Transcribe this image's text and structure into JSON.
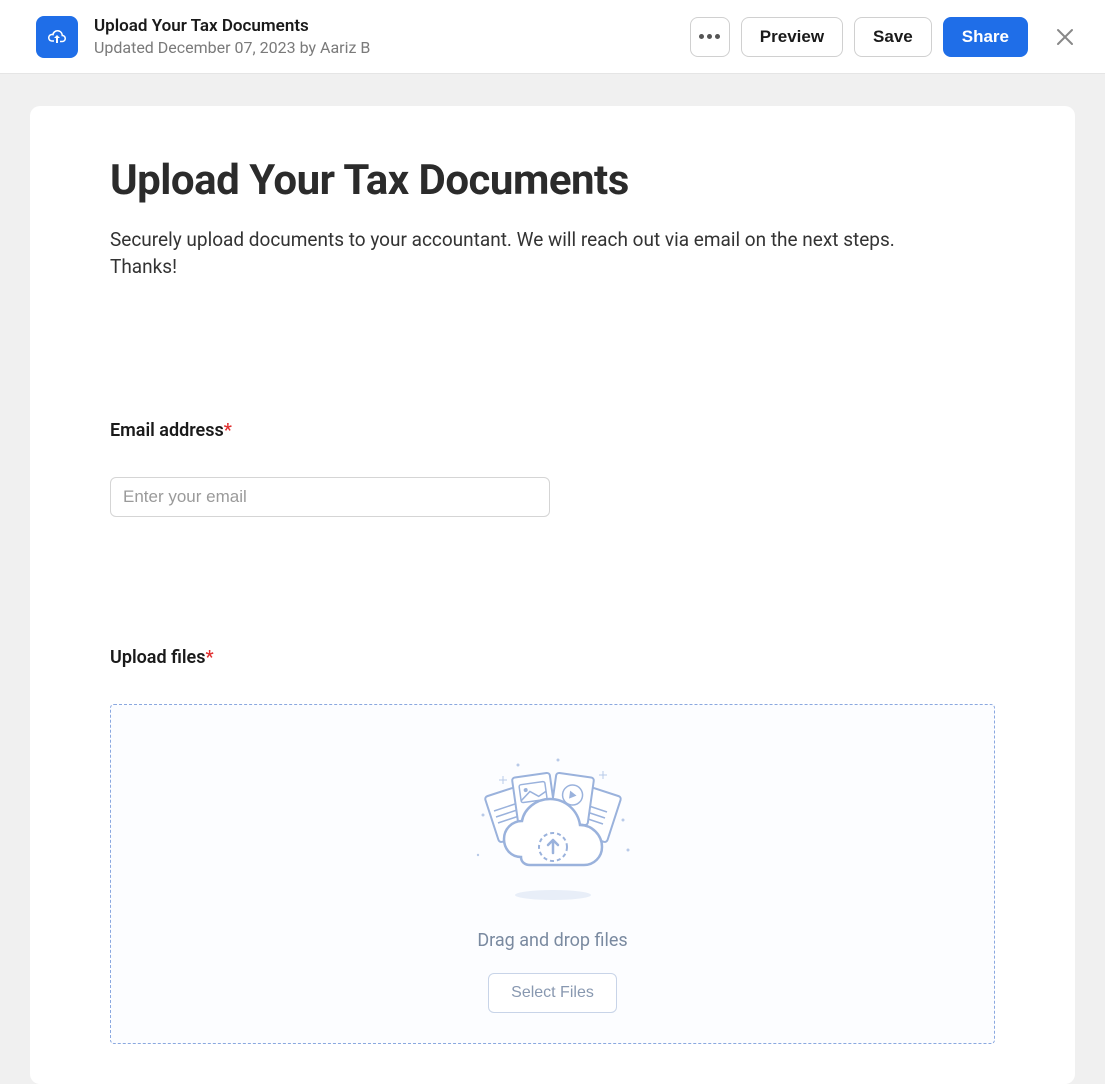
{
  "header": {
    "title": "Upload Your Tax Documents",
    "meta": "Updated December 07, 2023 by Aariz B",
    "preview_label": "Preview",
    "save_label": "Save",
    "share_label": "Share"
  },
  "form": {
    "title": "Upload Your Tax Documents",
    "description": "Securely upload documents to your accountant. We will reach out via email on the next steps. Thanks!",
    "email": {
      "label": "Email address",
      "placeholder": "Enter your email"
    },
    "upload": {
      "label": "Upload files",
      "drop_text": "Drag and drop files",
      "select_button": "Select Files"
    }
  }
}
